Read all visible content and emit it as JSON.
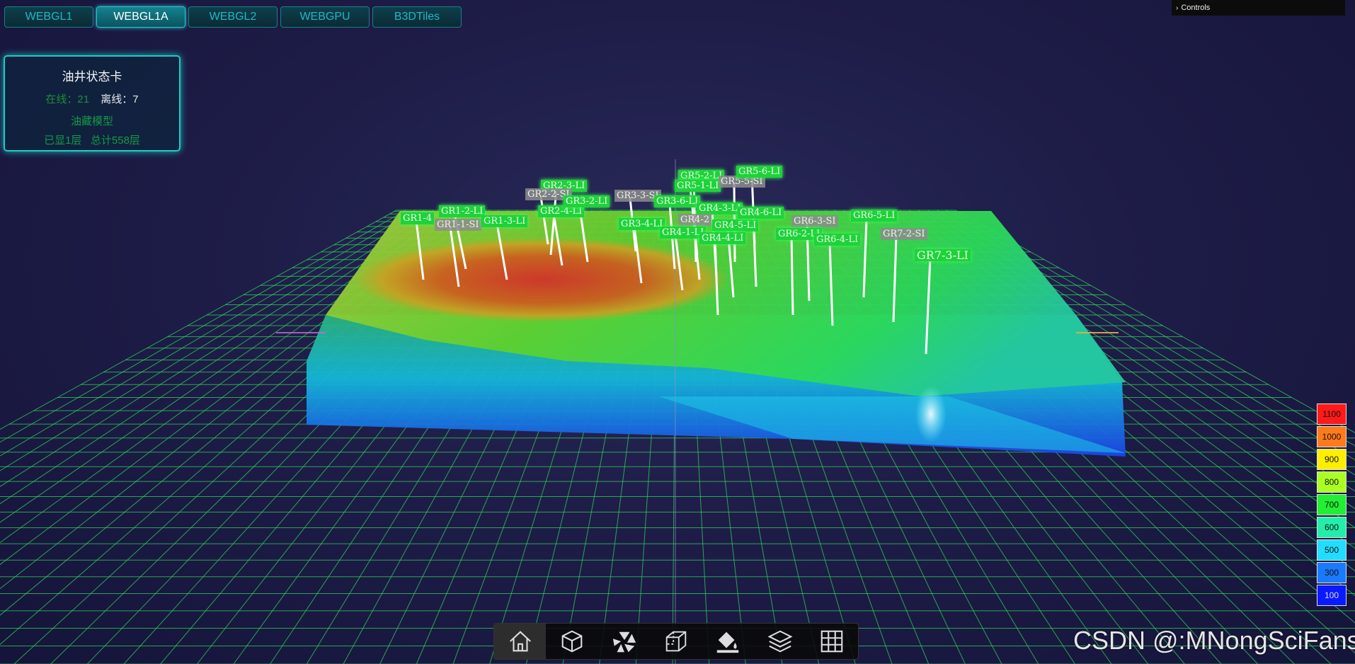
{
  "tabs": [
    {
      "label": "WEBGL1",
      "active": false
    },
    {
      "label": "WEBGL1A",
      "active": true
    },
    {
      "label": "WEBGL2",
      "active": false
    },
    {
      "label": "WEBGPU",
      "active": false
    },
    {
      "label": "B3DTiles",
      "active": false
    }
  ],
  "controls": {
    "label": "Controls"
  },
  "status_card": {
    "title": "油井状态卡",
    "online_label": "在线：",
    "online_count": "21",
    "offline_label": "离线：",
    "offline_count": "7",
    "model_label": "油藏模型",
    "layers_text": "已显1层   总计558层"
  },
  "legend": [
    {
      "value": "1100",
      "color": "#ff1a1a"
    },
    {
      "value": "1000",
      "color": "#ff7a1a"
    },
    {
      "value": "900",
      "color": "#ffee00"
    },
    {
      "value": "800",
      "color": "#aaff22"
    },
    {
      "value": "700",
      "color": "#22ee33"
    },
    {
      "value": "600",
      "color": "#22eeaa"
    },
    {
      "value": "500",
      "color": "#22ddff"
    },
    {
      "value": "300",
      "color": "#1a7aff"
    },
    {
      "value": "100",
      "color": "#0a1aff"
    }
  ],
  "toolbar": [
    {
      "icon": "home-icon",
      "active": true
    },
    {
      "icon": "cube-icon",
      "active": false
    },
    {
      "icon": "shutter-icon",
      "active": false
    },
    {
      "icon": "box-outline-icon",
      "active": false
    },
    {
      "icon": "paint-bucket-icon",
      "active": false
    },
    {
      "icon": "layers-icon",
      "active": false
    },
    {
      "icon": "grid-icon",
      "active": false
    }
  ],
  "watermark": "CSDN @:MNongSciFans",
  "wells": [
    {
      "label": "GR1-4",
      "status": "online"
    },
    {
      "label": "GR1-2-LI",
      "status": "online"
    },
    {
      "label": "GR1-1-SI",
      "status": "offline"
    },
    {
      "label": "GR1-3-LI",
      "status": "online"
    },
    {
      "label": "GR2-3-LI",
      "status": "online"
    },
    {
      "label": "GR2-2-SI",
      "status": "offline"
    },
    {
      "label": "GR2-4-LI",
      "status": "online"
    },
    {
      "label": "GR3-2-LI",
      "status": "online"
    },
    {
      "label": "GR3-3-SI",
      "status": "offline"
    },
    {
      "label": "GR3-4-LI",
      "status": "online"
    },
    {
      "label": "GR3-6-LI",
      "status": "online"
    },
    {
      "label": "GR5-2-LI",
      "status": "online"
    },
    {
      "label": "GR5-1-LI",
      "status": "online"
    },
    {
      "label": "GR5-5-SI",
      "status": "offline"
    },
    {
      "label": "GR5-6-LI",
      "status": "online"
    },
    {
      "label": "GR4-3-LI",
      "status": "online"
    },
    {
      "label": "GR4-2",
      "status": "offline"
    },
    {
      "label": "GR4-1-LI",
      "status": "online"
    },
    {
      "label": "GR4-5-LI",
      "status": "online"
    },
    {
      "label": "GR4-4-LI",
      "status": "online"
    },
    {
      "label": "GR4-6-LI",
      "status": "online"
    },
    {
      "label": "GR6-3-SI",
      "status": "offline"
    },
    {
      "label": "GR6-5-LI",
      "status": "online"
    },
    {
      "label": "GR6-2-LI",
      "status": "online"
    },
    {
      "label": "GR6-4-LI",
      "status": "online"
    },
    {
      "label": "GR7-2-SI",
      "status": "offline"
    },
    {
      "label": "GR7-3-LI",
      "status": "online"
    }
  ]
}
